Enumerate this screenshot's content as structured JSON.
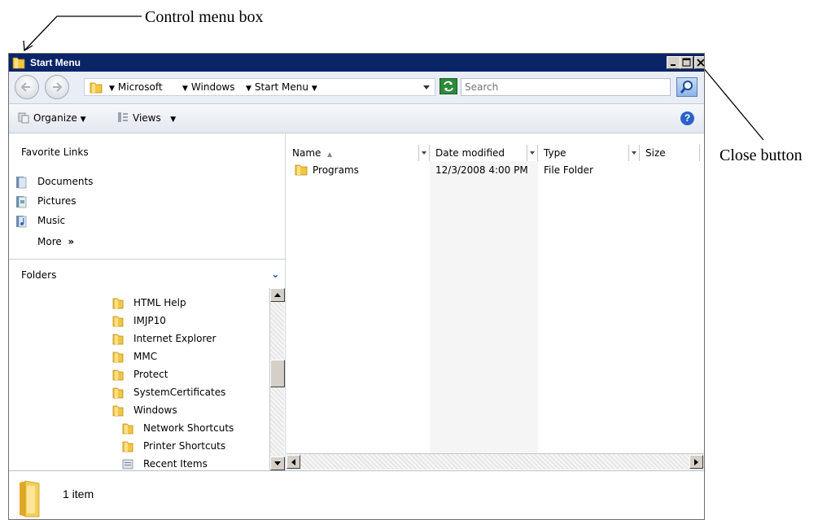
{
  "annotations": {
    "control_menu_box": "Control menu box",
    "close_button": "Close button"
  },
  "window": {
    "title": "Start Menu"
  },
  "address_bar": {
    "crumbs": [
      "Microsoft",
      "Windows",
      "Start Menu"
    ],
    "search_placeholder": "Search"
  },
  "toolbar": {
    "organize_label": "Organize",
    "views_label": "Views"
  },
  "favorite_links": {
    "title": "Favorite Links",
    "items": [
      {
        "label": "Documents",
        "icon": "documents-icon"
      },
      {
        "label": "Pictures",
        "icon": "pictures-icon"
      },
      {
        "label": "Music",
        "icon": "music-icon"
      }
    ],
    "more_label": "More",
    "more_chevron": "»"
  },
  "folders": {
    "title": "Folders",
    "items": [
      {
        "label": "HTML Help",
        "level": 0,
        "icon": "folder-icon"
      },
      {
        "label": "IMJP10",
        "level": 0,
        "icon": "folder-icon"
      },
      {
        "label": "Internet Explorer",
        "level": 0,
        "icon": "folder-icon"
      },
      {
        "label": "MMC",
        "level": 0,
        "icon": "folder-icon"
      },
      {
        "label": "Protect",
        "level": 0,
        "icon": "folder-icon"
      },
      {
        "label": "SystemCertificates",
        "level": 0,
        "icon": "folder-icon"
      },
      {
        "label": "Windows",
        "level": 0,
        "icon": "folder-icon"
      },
      {
        "label": "Network Shortcuts",
        "level": 1,
        "icon": "folder-icon"
      },
      {
        "label": "Printer Shortcuts",
        "level": 1,
        "icon": "folder-icon"
      },
      {
        "label": "Recent Items",
        "level": 1,
        "icon": "recent-items-icon"
      }
    ]
  },
  "file_list": {
    "columns": [
      "Name",
      "Date modified",
      "Type",
      "Size"
    ],
    "sort_indicator": "▲",
    "rows": [
      {
        "name": "Programs",
        "date_modified": "12/3/2008 4:00 PM",
        "type": "File Folder",
        "size": ""
      }
    ]
  },
  "status": {
    "item_count": "1 item"
  },
  "colors": {
    "titlebar": "#0a2468",
    "address_bar": "#e9eef6",
    "folder_yellow": "#f2c640"
  }
}
